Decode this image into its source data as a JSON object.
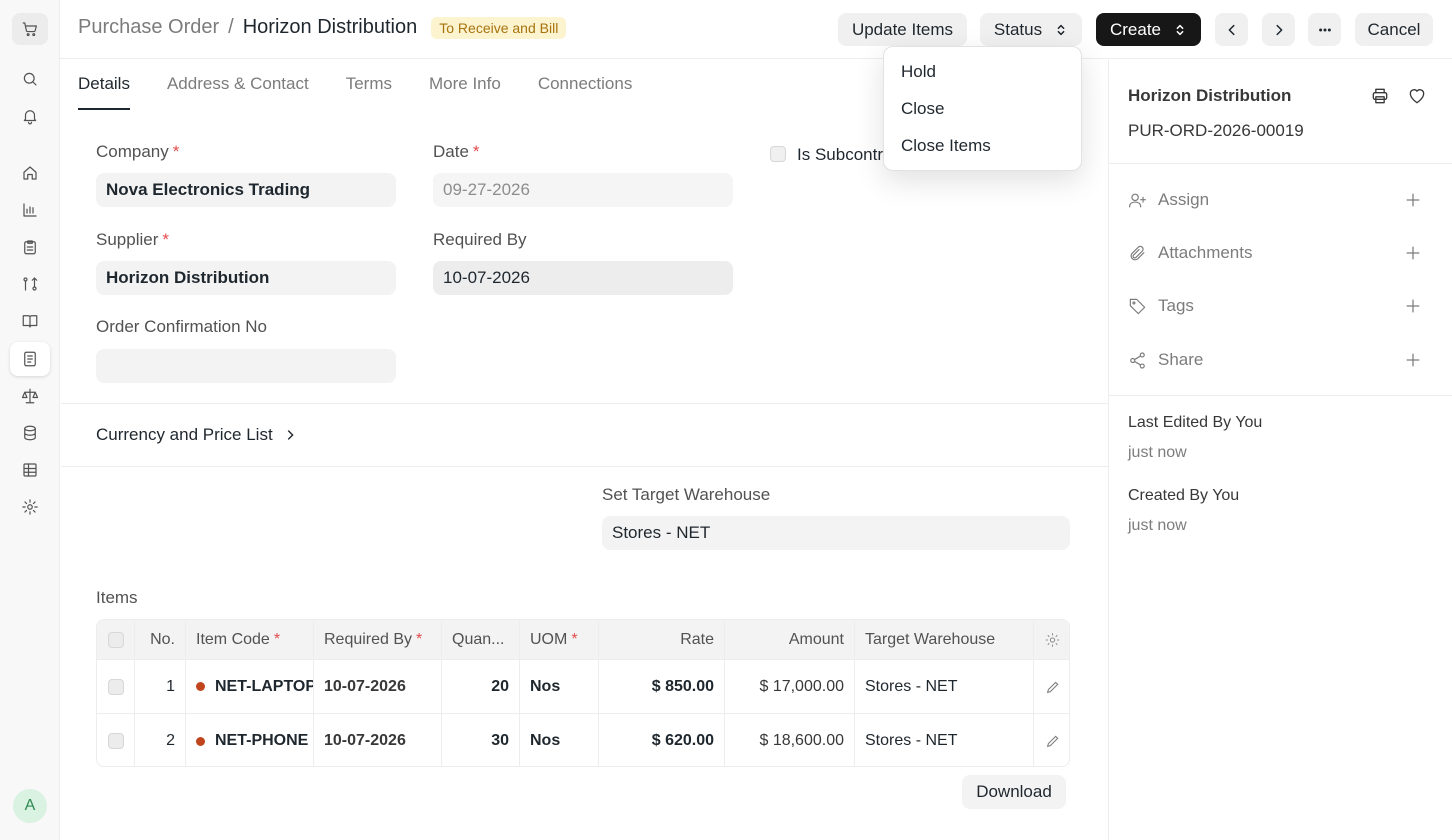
{
  "breadcrumb": {
    "parent": "Purchase Order",
    "separator": "/",
    "current": "Horizon Distribution"
  },
  "status_badge": "To Receive and Bill",
  "toolbar": {
    "update_items": "Update Items",
    "status": "Status",
    "create": "Create",
    "cancel": "Cancel"
  },
  "tabs": [
    "Details",
    "Address & Contact",
    "Terms",
    "More Info",
    "Connections"
  ],
  "form": {
    "company_label": "Company",
    "company_value": "Nova Electronics Trading",
    "date_label": "Date",
    "date_value": "09-27-2026",
    "subcontracted_label": "Is Subcontracted",
    "supplier_label": "Supplier",
    "supplier_value": "Horizon Distribution",
    "required_by_label": "Required By",
    "required_by_value": "10-07-2026",
    "order_confirmation_label": "Order Confirmation No",
    "order_confirmation_value": "",
    "currency_section": "Currency and Price List",
    "target_warehouse_label": "Set Target Warehouse",
    "target_warehouse_value": "Stores - NET",
    "items_label": "Items",
    "required_mark": "*"
  },
  "items_table": {
    "columns": [
      "No.",
      "Item Code",
      "Required By",
      "Quan...",
      "UOM",
      "Rate",
      "Amount",
      "Target Warehouse"
    ],
    "rows": [
      {
        "no": "1",
        "item_code": "NET-LAPTOP",
        "required_by": "10-07-2026",
        "qty": "20",
        "uom": "Nos",
        "rate": "$ 850.00",
        "amount": "$ 17,000.00",
        "warehouse": "Stores - NET"
      },
      {
        "no": "2",
        "item_code": "NET-PHONE",
        "required_by": "10-07-2026",
        "qty": "30",
        "uom": "Nos",
        "rate": "$ 620.00",
        "amount": "$ 18,600.00",
        "warehouse": "Stores - NET"
      }
    ],
    "download": "Download"
  },
  "status_menu": [
    "Hold",
    "Close",
    "Close Items"
  ],
  "sidebar": {
    "title": "Horizon Distribution",
    "doc_id": "PUR-ORD-2026-00019",
    "actions": [
      "Assign",
      "Attachments",
      "Tags",
      "Share"
    ],
    "last_edited_label": "Last Edited By You",
    "last_edited_value": "just now",
    "created_label": "Created By You",
    "created_value": "just now"
  },
  "user_avatar": "A",
  "colors": {
    "accent": "#171717",
    "badge_bg": "#fcf3cf",
    "badge_text": "#a8730d",
    "required": "#e24c4c",
    "item_dot": "#c0451d"
  }
}
